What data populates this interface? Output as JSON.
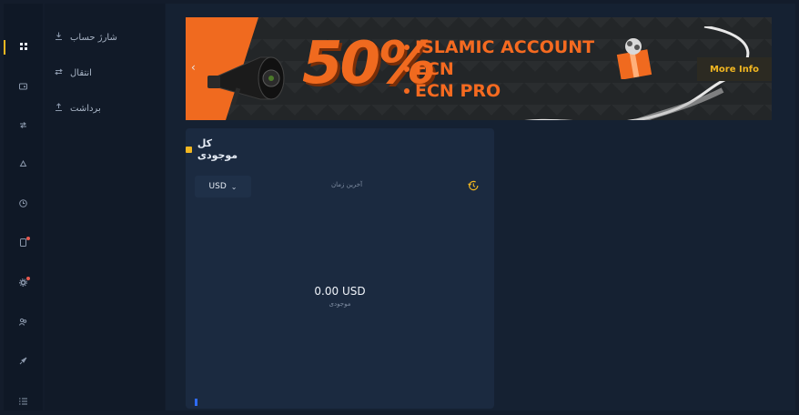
{
  "rail": {
    "items": [
      {
        "icon": "grid-icon",
        "glyph": "▪▪",
        "active": true
      },
      {
        "icon": "wallet-icon",
        "glyph": "▣"
      },
      {
        "icon": "transfer-icon",
        "glyph": "⇆"
      },
      {
        "icon": "recycle-icon",
        "glyph": "♲"
      },
      {
        "icon": "clock-icon",
        "glyph": "◷"
      },
      {
        "icon": "document-icon",
        "glyph": "▯",
        "badge": true
      },
      {
        "icon": "settings-icon",
        "glyph": "⚙",
        "badge": true
      },
      {
        "icon": "people-icon",
        "glyph": "☍"
      },
      {
        "icon": "rocket-icon",
        "glyph": "➶"
      },
      {
        "icon": "list-icon",
        "glyph": "☰"
      }
    ]
  },
  "subnav": {
    "items": [
      {
        "label": "شارژ حساب",
        "icon": "deposit-icon",
        "glyph": "⤓"
      },
      {
        "label": "انتقال",
        "icon": "transfer-icon",
        "glyph": "⇄"
      },
      {
        "label": "برداشت",
        "icon": "withdraw-icon",
        "glyph": "⤒"
      }
    ]
  },
  "banner": {
    "percent": "50%",
    "points": [
      "ISLAMIC ACCOUNT",
      "ECN",
      "ECN PRO"
    ],
    "cta": "More Info"
  },
  "balance": {
    "title": "کل موجودی",
    "currency": "USD",
    "last_time_label": "آخرین زمان",
    "amount": "0.00 USD",
    "amount_label": "موجودی"
  },
  "colors": {
    "accent": "#f2b721",
    "promo_orange": "#f06a1f",
    "card_bg": "#1b2a40",
    "badge": "#e85a4f"
  }
}
